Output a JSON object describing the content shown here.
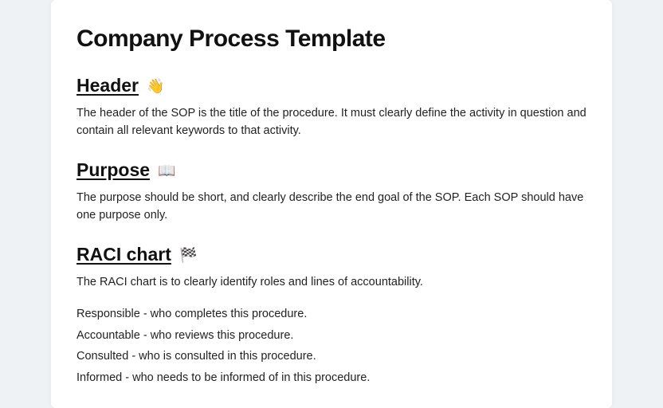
{
  "document": {
    "title": "Company Process Template",
    "sections": {
      "header": {
        "heading": "Header",
        "emoji": "👋",
        "body": "The header of the SOP is the title of the procedure. It must clearly define the activity in question and contain all relevant keywords to that activity."
      },
      "purpose": {
        "heading": "Purpose",
        "emoji": "📖",
        "body": "The purpose should be short, and clearly describe the end goal of the SOP. Each SOP should have one purpose only."
      },
      "raci": {
        "heading": "RACI chart",
        "emoji": "🏁",
        "intro": "The RACI chart is to clearly identify roles and lines of accountability.",
        "roles": {
          "responsible": "Responsible - who completes this procedure.",
          "accountable": "Accountable - who reviews this procedure.",
          "consulted": "Consulted - who is consulted in this procedure.",
          "informed": "Informed - who needs to be informed of in this procedure."
        }
      }
    }
  }
}
